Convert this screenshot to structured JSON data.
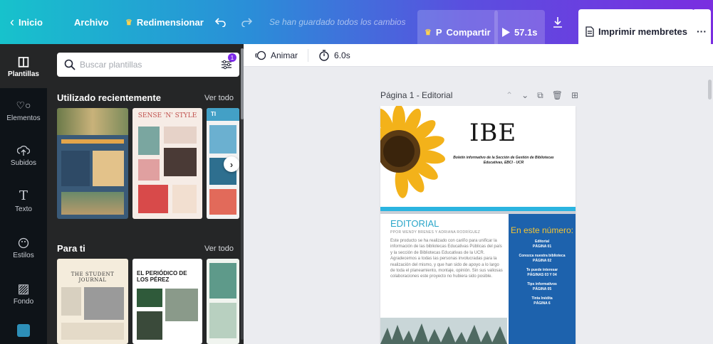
{
  "topbar": {
    "home_label": "Inicio",
    "file_label": "Archivo",
    "resize_label": "Redimensionar",
    "save_status": "Se han guardado todos los cambios",
    "share_label": "Compartir",
    "share_avatar": "P",
    "duration_label": "57.1s",
    "print_label": "Imprimir membretes",
    "more_label": "···"
  },
  "rail": {
    "items": [
      {
        "label": "Plantillas",
        "icon": "templates-icon"
      },
      {
        "label": "Elementos",
        "icon": "elements-icon"
      },
      {
        "label": "Subidos",
        "icon": "uploads-icon"
      },
      {
        "label": "Texto",
        "icon": "text-icon"
      },
      {
        "label": "Estilos",
        "icon": "styles-icon"
      },
      {
        "label": "Fondo",
        "icon": "background-icon"
      }
    ]
  },
  "panel": {
    "search_placeholder": "Buscar plantillas",
    "filter_badge": "1",
    "recent_title": "Utilizado recientemente",
    "recent_see_all": "Ver todo",
    "foryou_title": "Para ti",
    "foryou_see_all": "Ver todo",
    "recent_thumbs": [
      {
        "title": "SENSE 'N' STYLE"
      },
      {
        "title": "TI"
      }
    ],
    "foryou_thumbs": [
      {
        "title": "THE STUDENT JOURNAL"
      },
      {
        "title": "EL PERIÓDICO DE LOS PÉREZ"
      }
    ]
  },
  "editbar": {
    "animate_label": "Animar",
    "timing_label": "6.0s"
  },
  "page": {
    "label": "Página 1 - Editorial",
    "doc_title": "IBE",
    "doc_subtitle": "Boletín informativo de la Sección de Gestión de Bibliotecas Educativas, EBCI - UCR",
    "editorial_heading": "EDITORIAL",
    "editorial_byline": "PPOR WENDY BRENES Y ADRIANA RODRÍGUEZ",
    "editorial_body": "Este producto se ha realizado con cariño para unificar la información de las bibliotecas Educativas Públicas del país y la sección de Bibliotecas Educativas de la UCR. Agradecemos a todas las personas involucradas para la realización del mismo, y que han sido de apoyo a lo largo de toda el planeamiento, montaje, opinión. Sin sus valiosas colaboraciones este proyecto no hubiera sido posible.",
    "sidebar_title": "En este número:",
    "sidebar_entries": [
      {
        "title": "Editorial",
        "page": "PÁGINA 01"
      },
      {
        "title": "Conozca nuestra biblioteca",
        "page": "PÁGINA 02"
      },
      {
        "title": "Te puede interesar",
        "page": "PÁGINAS 03 Y 04"
      },
      {
        "title": "Tips informativos",
        "page": "PÁGINA 05"
      },
      {
        "title": "Tinta Inédita",
        "page": "PÁGINA 6"
      }
    ]
  },
  "colors": {
    "accent_purple": "#7d2ae8",
    "rail_bg": "#0e1318",
    "panel_bg": "#252627",
    "sidebar_blue": "#1d62ad",
    "heading_teal": "#2aa6c9",
    "sidebar_yellow": "#f5c533"
  }
}
